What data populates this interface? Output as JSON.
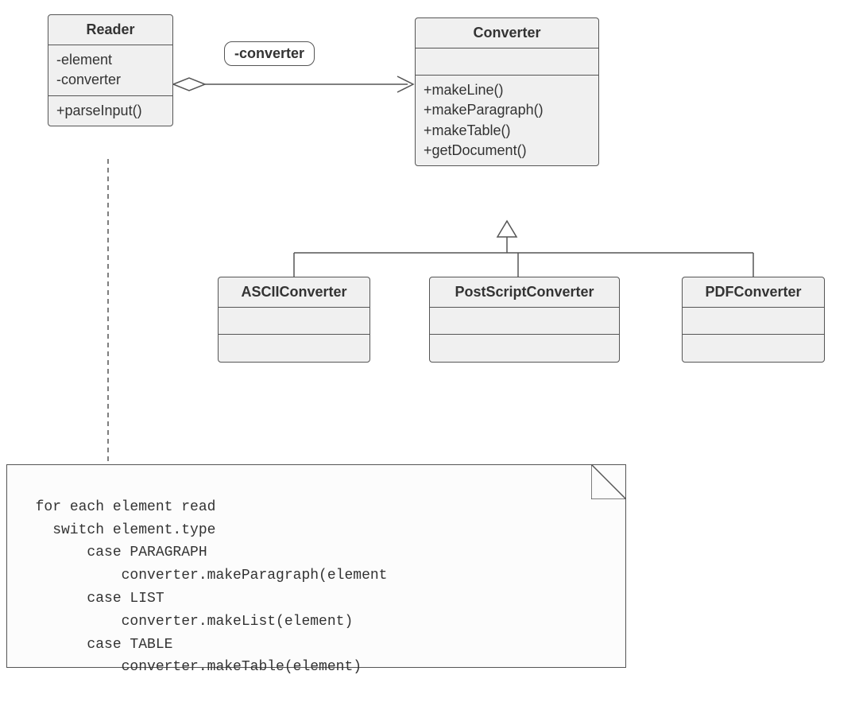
{
  "classes": {
    "reader": {
      "name": "Reader",
      "attributes": "-element\n-converter",
      "operations": "+parseInput()"
    },
    "converter": {
      "name": "Converter",
      "attributes": "",
      "operations": "+makeLine()\n+makeParagraph()\n+makeTable()\n+getDocument()"
    },
    "ascii": {
      "name": "ASCIIConverter"
    },
    "ps": {
      "name": "PostScriptConverter"
    },
    "pdf": {
      "name": "PDFConverter"
    }
  },
  "association_label": "-converter",
  "note_code": "for each element read\n    switch element.type\n        case PARAGRAPH\n            converter.makeParagraph(element\n        case LIST\n            converter.makeList(element)\n        case TABLE\n            converter.makeTable(element)"
}
